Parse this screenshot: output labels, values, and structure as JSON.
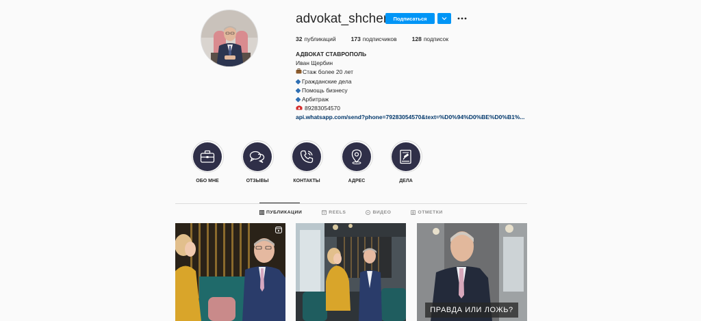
{
  "profile": {
    "username": "advokat_shcherbin",
    "follow_label": "Подписаться",
    "dropdown_icon": "chevron-down-icon",
    "more_icon": "more-icon",
    "accent_color": "#0095f6"
  },
  "stats": [
    {
      "count": "32",
      "label": "публикаций"
    },
    {
      "count": "173",
      "label": "подписчиков"
    },
    {
      "count": "128",
      "label": "подписок"
    }
  ],
  "bio": {
    "title": "АДВОКАТ СТАВРОПОЛЬ",
    "name": "Иван Щербин",
    "experience": "Стаж более 20 лет",
    "services": [
      "Гражданские дела",
      "Помощь бизнесу",
      "Арбитраж"
    ],
    "phone": "89283054570",
    "link": "api.whatsapp.com/send?phone=79283054570&text=%D0%94%D0%BE%D0%B1%..."
  },
  "highlights": [
    {
      "label": "ОБО МНЕ",
      "icon": "briefcase-icon"
    },
    {
      "label": "ОТЗЫВЫ",
      "icon": "chat-bubbles-icon"
    },
    {
      "label": "КОНТАКТЫ",
      "icon": "phone-icon"
    },
    {
      "label": "АДРЕС",
      "icon": "map-pin-icon"
    },
    {
      "label": "ДЕЛА",
      "icon": "gavel-document-icon"
    }
  ],
  "tabs": [
    {
      "label": "ПУБЛИКАЦИИ",
      "icon": "grid-icon",
      "active": true
    },
    {
      "label": "REELS",
      "icon": "reels-icon",
      "active": false
    },
    {
      "label": "ВИДЕО",
      "icon": "video-icon",
      "active": false
    },
    {
      "label": "ОТМЕТКИ",
      "icon": "tagged-icon",
      "active": false
    }
  ],
  "posts": [
    {
      "type": "reel",
      "badge_icon": "reels-icon"
    },
    {
      "type": "image"
    },
    {
      "type": "image",
      "overlay_text": "ПРАВДА ИЛИ ЛОЖЬ?"
    }
  ]
}
